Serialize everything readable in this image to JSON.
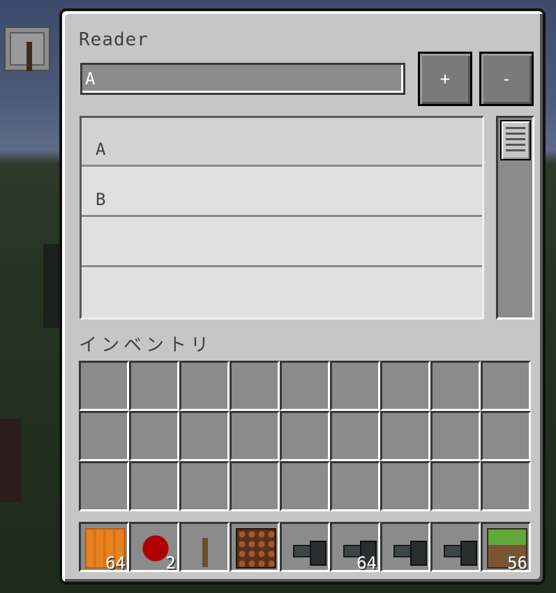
{
  "window": {
    "title": "Reader",
    "input_value": "A",
    "plus_label": "+",
    "minus_label": "-"
  },
  "list": {
    "rows": [
      "A",
      "B",
      "",
      ""
    ],
    "selected_index": 0
  },
  "inventory": {
    "label": "インベントリ",
    "main_rows": 3,
    "columns": 9,
    "hotbar": [
      {
        "icon": "pumpkin-icon",
        "count": "64"
      },
      {
        "icon": "redstone-dust-icon",
        "count": "2"
      },
      {
        "icon": "stick-icon",
        "count": ""
      },
      {
        "icon": "redstone-lamp-icon",
        "count": ""
      },
      {
        "icon": "bus-block-icon",
        "count": ""
      },
      {
        "icon": "bus-block-icon",
        "count": "64"
      },
      {
        "icon": "bus-block-icon",
        "count": ""
      },
      {
        "icon": "bus-block-icon",
        "count": ""
      },
      {
        "icon": "grass-block-icon",
        "count": "56"
      }
    ]
  },
  "colors": {
    "panel": "#c6c6c6",
    "slot": "#8b8b8b",
    "text": "#404040"
  }
}
